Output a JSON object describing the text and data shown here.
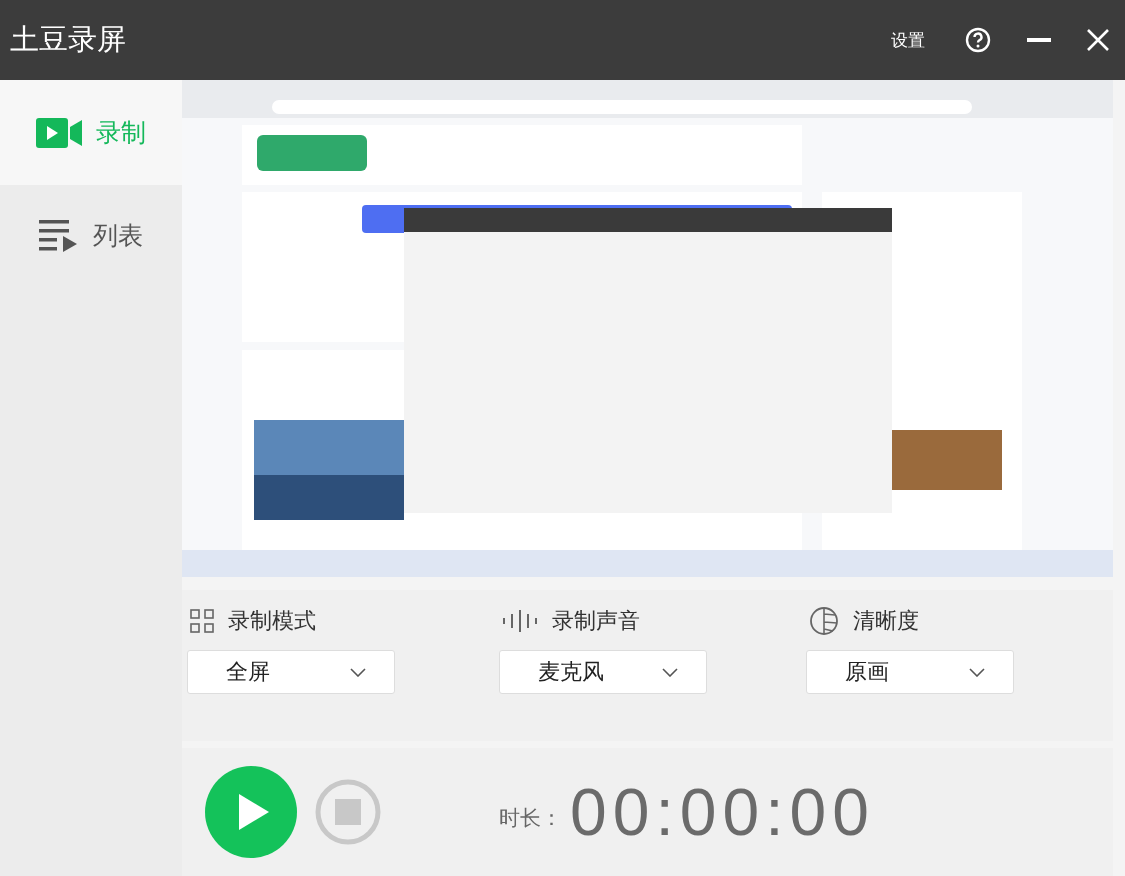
{
  "window": {
    "title": "土豆录屏",
    "settings": "设置"
  },
  "sidebar": {
    "items": [
      {
        "label": "录制",
        "kind": "record",
        "selected": true
      },
      {
        "label": "列表",
        "kind": "list",
        "selected": false
      }
    ]
  },
  "options": [
    {
      "kind": "mode",
      "label": "录制模式",
      "value": "全屏"
    },
    {
      "kind": "audio",
      "label": "录制声音",
      "value": "麦克风"
    },
    {
      "kind": "quality",
      "label": "清晰度",
      "value": "原画"
    }
  ],
  "controls": {
    "duration_label": "时长：",
    "duration": "00:00:00"
  }
}
